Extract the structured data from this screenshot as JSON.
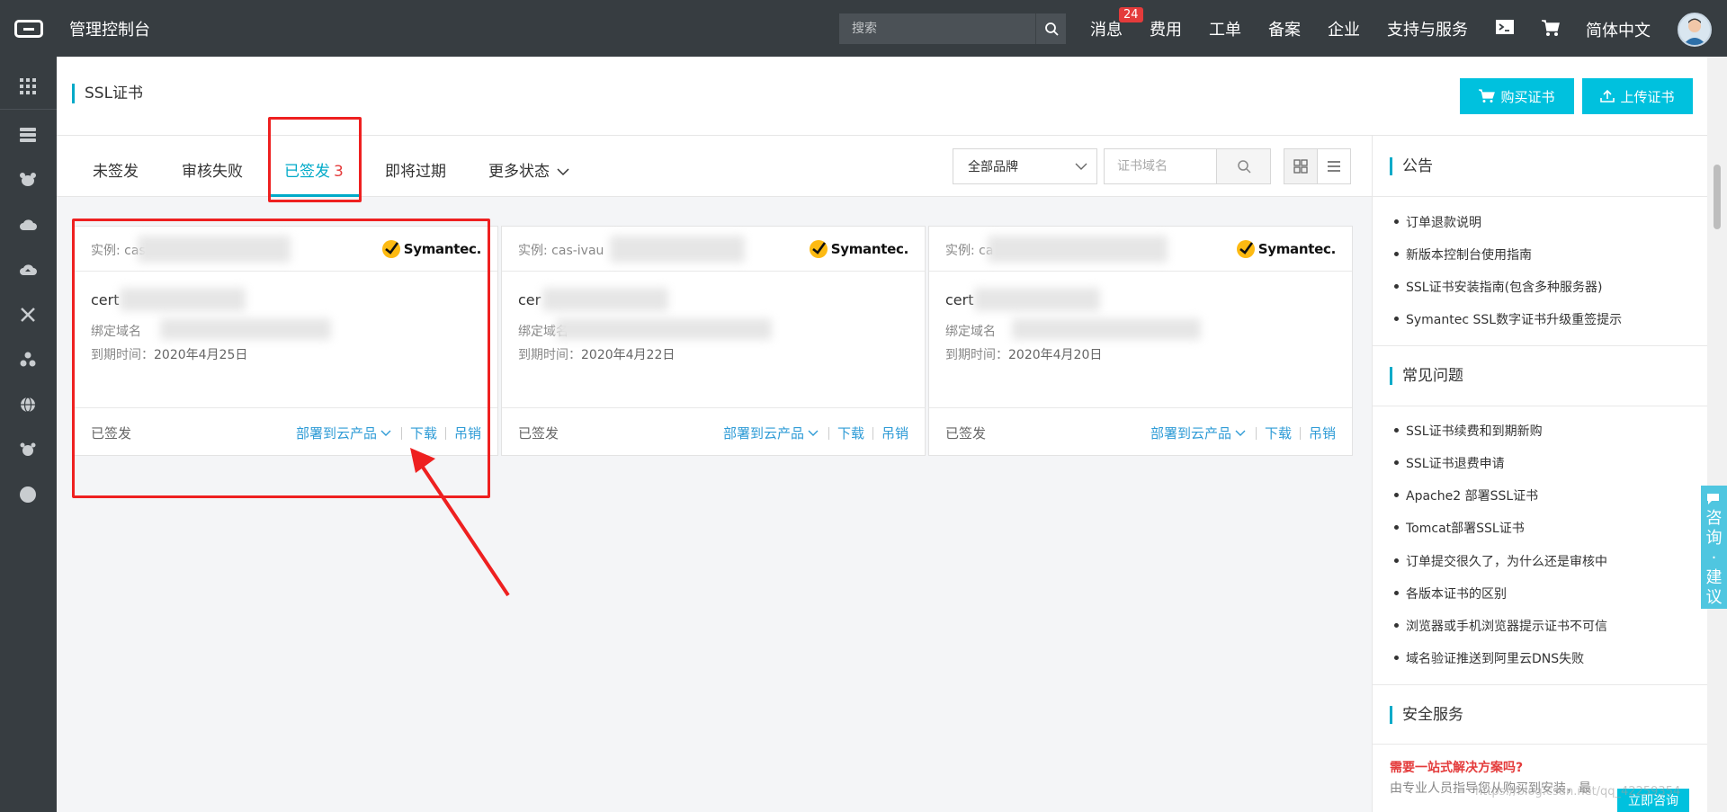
{
  "topbar": {
    "console_title": "管理控制台",
    "search_placeholder": "搜索",
    "nav": [
      {
        "label": "消息",
        "badge": "24"
      },
      {
        "label": "费用"
      },
      {
        "label": "工单"
      },
      {
        "label": "备案"
      },
      {
        "label": "企业"
      },
      {
        "label": "支持与服务"
      }
    ],
    "language": "简体中文"
  },
  "sidebar": {
    "icons": [
      "apps-grid-icon",
      "server-stack-icon",
      "dog-icon",
      "cloud-icon",
      "cloud-upload-icon",
      "network-icon",
      "cluster-icon",
      "globe-icon",
      "gear-dog-icon",
      "circle-icon"
    ]
  },
  "page": {
    "title": "SSL证书",
    "buy_label": "购买证书",
    "upload_label": "上传证书"
  },
  "tabs": [
    {
      "label": "未签发"
    },
    {
      "label": "审核失败"
    },
    {
      "label": "已签发",
      "count": "3"
    },
    {
      "label": "即将过期"
    },
    {
      "label": "更多状态"
    }
  ],
  "filters": {
    "brand": "全部品牌",
    "domain_placeholder": "证书域名"
  },
  "cards": [
    {
      "instance_label": "实例: cas",
      "brand": "Symantec.",
      "cert_name": "cert",
      "domain_label": "绑定域名",
      "domain_value": "",
      "expire_label": "到期时间：",
      "expire_value": "2020年4月25日",
      "status": "已签发",
      "deploy": "部署到云产品",
      "download": "下载",
      "revoke": "吊销"
    },
    {
      "instance_label": "实例: cas-ivau",
      "brand": "Symantec.",
      "cert_name": "cer",
      "domain_label": "绑定域名",
      "domain_value": "",
      "expire_label": "到期时间：",
      "expire_value": "2020年4月22日",
      "status": "已签发",
      "deploy": "部署到云产品",
      "download": "下载",
      "revoke": "吊销"
    },
    {
      "instance_label": "实例: ca",
      "brand": "Symantec.",
      "cert_name": "cert",
      "domain_label": "绑定域名",
      "domain_value": "",
      "expire_label": "到期时间：",
      "expire_value": "2020年4月20日",
      "status": "已签发",
      "deploy": "部署到云产品",
      "download": "下载",
      "revoke": "吊销"
    }
  ],
  "rightpanel": {
    "notice_title": "公告",
    "notices": [
      "订单退款说明",
      "新版本控制台使用指南",
      "SSL证书安装指南(包含多种服务器)",
      "Symantec SSL数字证书升级重签提示"
    ],
    "faq_title": "常见问题",
    "faqs": [
      "SSL证书续费和到期新购",
      "SSL证书退费申请",
      "Apache2 部署SSL证书",
      "Tomcat部署SSL证书",
      "订单提交很久了，为什么还是审核中",
      "各版本证书的区别",
      "浏览器或手机浏览器提示证书不可信",
      "域名验证推送到阿里云DNS失败"
    ],
    "security_title": "安全服务",
    "promo_title": "需要一站式解决方案吗?",
    "promo_text": "由专业人员指导您从购买到安装，最",
    "promo_button": "立即咨询"
  },
  "consult": [
    "咨",
    "询",
    "·",
    "建",
    "议"
  ],
  "watermark": "https://blog.csdn.net/qq_42259354",
  "colors": {
    "accent": "#00c1de",
    "topbar": "#373d41",
    "highlight": "#ee2020",
    "link": "#2e9bd6"
  }
}
